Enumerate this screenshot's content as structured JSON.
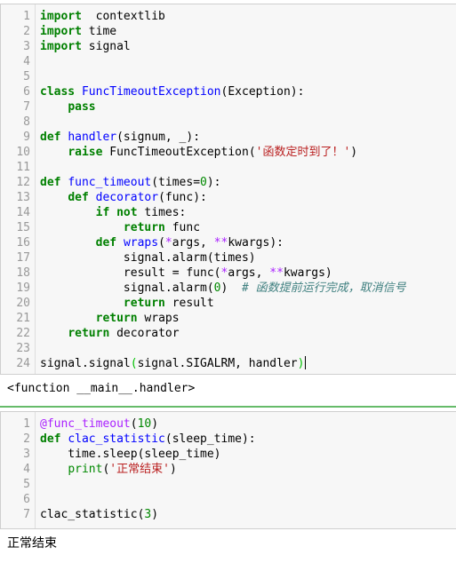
{
  "cells": [
    {
      "type": "code",
      "lines": [
        {
          "n": "1",
          "tokens": [
            [
              "kw",
              "import"
            ],
            [
              "",
              "  contextlib"
            ]
          ]
        },
        {
          "n": "2",
          "tokens": [
            [
              "kw",
              "import"
            ],
            [
              "",
              " time"
            ]
          ]
        },
        {
          "n": "3",
          "tokens": [
            [
              "kw",
              "import"
            ],
            [
              "",
              " signal"
            ]
          ]
        },
        {
          "n": "4",
          "tokens": []
        },
        {
          "n": "5",
          "tokens": []
        },
        {
          "n": "6",
          "tokens": [
            [
              "kw",
              "class"
            ],
            [
              "",
              " "
            ],
            [
              "def",
              "FuncTimeoutException"
            ],
            [
              "",
              "(Exception):"
            ]
          ]
        },
        {
          "n": "7",
          "tokens": [
            [
              "",
              "    "
            ],
            [
              "kw",
              "pass"
            ]
          ]
        },
        {
          "n": "8",
          "tokens": []
        },
        {
          "n": "9",
          "tokens": [
            [
              "kw",
              "def"
            ],
            [
              "",
              " "
            ],
            [
              "def",
              "handler"
            ],
            [
              "",
              "(signum, _):"
            ]
          ]
        },
        {
          "n": "10",
          "tokens": [
            [
              "",
              "    "
            ],
            [
              "kw",
              "raise"
            ],
            [
              "",
              " FuncTimeoutException("
            ],
            [
              "str",
              "'函数定时到了！'"
            ],
            [
              "",
              ")"
            ]
          ]
        },
        {
          "n": "11",
          "tokens": []
        },
        {
          "n": "12",
          "tokens": [
            [
              "kw",
              "def"
            ],
            [
              "",
              " "
            ],
            [
              "def",
              "func_timeout"
            ],
            [
              "",
              "(times="
            ],
            [
              "num",
              "0"
            ],
            [
              "",
              "):"
            ]
          ]
        },
        {
          "n": "13",
          "tokens": [
            [
              "",
              "    "
            ],
            [
              "kw",
              "def"
            ],
            [
              "",
              " "
            ],
            [
              "def",
              "decorator"
            ],
            [
              "",
              "(func):"
            ]
          ]
        },
        {
          "n": "14",
          "tokens": [
            [
              "",
              "        "
            ],
            [
              "kw",
              "if"
            ],
            [
              "",
              " "
            ],
            [
              "kw",
              "not"
            ],
            [
              "",
              " times:"
            ]
          ]
        },
        {
          "n": "15",
          "tokens": [
            [
              "",
              "            "
            ],
            [
              "kw",
              "return"
            ],
            [
              "",
              " func"
            ]
          ]
        },
        {
          "n": "16",
          "tokens": [
            [
              "",
              "        "
            ],
            [
              "kw",
              "def"
            ],
            [
              "",
              " "
            ],
            [
              "def",
              "wraps"
            ],
            [
              "",
              "("
            ],
            [
              "op",
              "*"
            ],
            [
              "",
              "args, "
            ],
            [
              "op",
              "**"
            ],
            [
              "",
              "kwargs):"
            ]
          ]
        },
        {
          "n": "17",
          "tokens": [
            [
              "",
              "            signal.alarm(times)"
            ]
          ]
        },
        {
          "n": "18",
          "tokens": [
            [
              "",
              "            result = func("
            ],
            [
              "op",
              "*"
            ],
            [
              "",
              "args, "
            ],
            [
              "op",
              "**"
            ],
            [
              "",
              "kwargs)"
            ]
          ]
        },
        {
          "n": "19",
          "tokens": [
            [
              "",
              "            signal.alarm("
            ],
            [
              "num",
              "0"
            ],
            [
              "",
              ")  "
            ],
            [
              "cm",
              "# 函数提前运行完成，取消信号"
            ]
          ]
        },
        {
          "n": "20",
          "tokens": [
            [
              "",
              "            "
            ],
            [
              "kw",
              "return"
            ],
            [
              "",
              " result"
            ]
          ]
        },
        {
          "n": "21",
          "tokens": [
            [
              "",
              "        "
            ],
            [
              "kw",
              "return"
            ],
            [
              "",
              " wraps"
            ]
          ]
        },
        {
          "n": "22",
          "tokens": [
            [
              "",
              "    "
            ],
            [
              "kw",
              "return"
            ],
            [
              "",
              " decorator"
            ]
          ]
        },
        {
          "n": "23",
          "tokens": []
        },
        {
          "n": "24",
          "tokens": [
            [
              "",
              "signal.signal"
            ],
            [
              "match",
              "("
            ],
            [
              "",
              "signal.SIGALRM, handler"
            ],
            [
              "match",
              ")"
            ],
            [
              "cursor",
              ""
            ]
          ]
        }
      ],
      "output": "<function __main__.handler>"
    },
    {
      "type": "code",
      "lines": [
        {
          "n": "1",
          "tokens": [
            [
              "dec",
              "@func_timeout"
            ],
            [
              "",
              "("
            ],
            [
              "num",
              "10"
            ],
            [
              "",
              ")"
            ]
          ]
        },
        {
          "n": "2",
          "tokens": [
            [
              "kw",
              "def"
            ],
            [
              "",
              " "
            ],
            [
              "def",
              "clac_statistic"
            ],
            [
              "",
              "(sleep_time):"
            ]
          ]
        },
        {
          "n": "3",
          "tokens": [
            [
              "",
              "    time.sleep(sleep_time)"
            ]
          ]
        },
        {
          "n": "4",
          "tokens": [
            [
              "",
              "    "
            ],
            [
              "num",
              "print"
            ],
            [
              "",
              "("
            ],
            [
              "str",
              "'正常结束'"
            ],
            [
              "",
              ")"
            ]
          ]
        },
        {
          "n": "5",
          "tokens": []
        },
        {
          "n": "6",
          "tokens": []
        },
        {
          "n": "7",
          "tokens": [
            [
              "",
              "clac_statistic("
            ],
            [
              "num",
              "3"
            ],
            [
              "",
              ")"
            ]
          ]
        }
      ],
      "output": "正常结束"
    }
  ],
  "colors": {
    "keyword": "#008000",
    "definition": "#0000ff",
    "number": "#008800",
    "string": "#ba2121",
    "operator": "#aa22ff",
    "comment": "#408080",
    "selected_border": "#66bb6a"
  }
}
